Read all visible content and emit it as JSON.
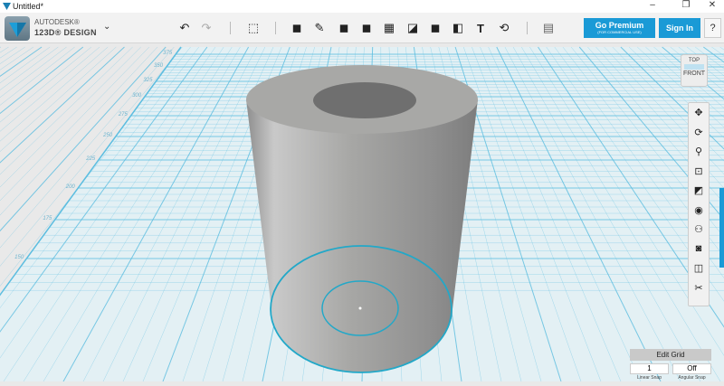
{
  "window": {
    "title": "Untitled*",
    "minimize": "–",
    "restore": "❐",
    "close": "✕"
  },
  "brand": {
    "line1": "AUTODESK®",
    "line2": "123D® DESIGN"
  },
  "toolbar": {
    "items": [
      {
        "name": "undo",
        "glyph": "↶"
      },
      {
        "name": "redo",
        "glyph": "↷"
      },
      {
        "name": "import",
        "glyph": "⬚"
      },
      {
        "name": "primitives",
        "glyph": "◼"
      },
      {
        "name": "sketch",
        "glyph": "✎"
      },
      {
        "name": "construct",
        "glyph": "◼"
      },
      {
        "name": "modify",
        "glyph": "◼"
      },
      {
        "name": "pattern",
        "glyph": "▦"
      },
      {
        "name": "grouping",
        "glyph": "◪"
      },
      {
        "name": "combine",
        "glyph": "◼"
      },
      {
        "name": "measure",
        "glyph": "◧"
      },
      {
        "name": "text",
        "glyph": "T"
      },
      {
        "name": "snap",
        "glyph": "⟲"
      },
      {
        "name": "material",
        "glyph": "▤"
      }
    ],
    "go_premium": "Go Premium",
    "go_premium_sub": "(FOR COMMERCIAL USE)",
    "sign_in": "Sign In",
    "help": "?"
  },
  "viewcube": {
    "top": "TOP",
    "front": "FRONT"
  },
  "nav_tools": [
    "✥",
    "⟳",
    "⚲",
    "⊡",
    "◩",
    "◉",
    "⚇",
    "◙",
    "◫",
    "✂"
  ],
  "grid_labels": [
    "375",
    "350",
    "325",
    "300",
    "275",
    "250",
    "225",
    "200",
    "175",
    "150"
  ],
  "edit_grid": {
    "title": "Edit Grid",
    "linear_snap": "1",
    "angular_snap": "Off",
    "linear_label": "Linear Snap",
    "angular_label": "Angular Snap"
  },
  "colors": {
    "accent": "#1a9ad6",
    "grid": "#5bbde0",
    "selection": "#22a8c8"
  }
}
